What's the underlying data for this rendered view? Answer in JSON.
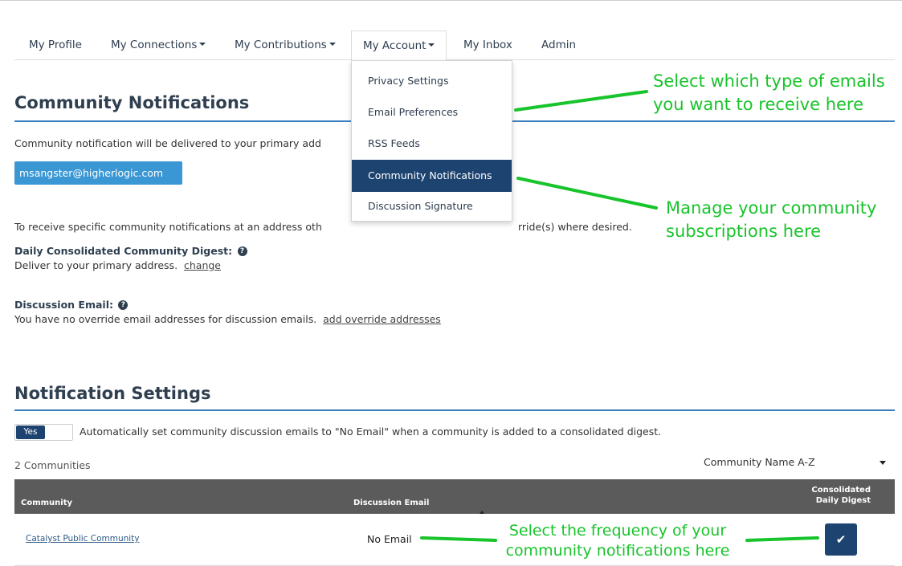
{
  "nav": {
    "tabs": [
      {
        "label": "My Profile",
        "caret": false
      },
      {
        "label": "My Connections",
        "caret": true
      },
      {
        "label": "My Contributions",
        "caret": true
      },
      {
        "label": "My Account",
        "caret": true,
        "active": true
      },
      {
        "label": "My Inbox",
        "caret": false
      },
      {
        "label": "Admin",
        "caret": false
      }
    ]
  },
  "dropdown": {
    "items": [
      "Privacy Settings",
      "Email Preferences",
      "RSS Feeds",
      "Community Notifications",
      "Discussion Signature"
    ],
    "selected_index": 3
  },
  "community_notifications": {
    "title": "Community Notifications",
    "intro": "Community notification will be delivered to your primary add",
    "primary_email": "msangster@higherlogic.com",
    "override_text_left": "To receive specific community notifications at an address oth",
    "override_text_right": "rride(s) where desired.",
    "daily_digest": {
      "label": "Daily Consolidated Community Digest:",
      "desc": "Deliver to your primary address.",
      "link": "change"
    },
    "discussion_email": {
      "label": "Discussion Email:",
      "desc": "You have no override email addresses for discussion emails.",
      "link": "add override addresses"
    }
  },
  "notification_settings": {
    "title": "Notification Settings",
    "toggle_label": "Yes",
    "toggle_on": true,
    "toggle_desc": "Automatically set community discussion emails to \"No Email\" when a community is added to a consolidated digest.",
    "count_text": "2 Communities",
    "sort_label": "Community Name A-Z",
    "table": {
      "headers": {
        "community": "Community",
        "discussion_email": "Discussion Email",
        "digest_line1": "Consolidated",
        "digest_line2": "Daily Digest"
      },
      "rows": [
        {
          "community": "Catalyst Public Community",
          "discussion_email": "No Email",
          "digest_checked": true
        }
      ]
    }
  },
  "annotations": {
    "emails": [
      "Select which type of emails",
      "you want to receive here"
    ],
    "subscriptions": [
      "Manage your community",
      "subscriptions here"
    ],
    "frequency": [
      "Select the frequency of your",
      "community notifications here"
    ]
  },
  "colors": {
    "accent": "#1d4370",
    "badge": "#3a97d4",
    "rule": "#3b7fbf",
    "annotation": "#18c42b",
    "table_header": "#5b5b5b"
  }
}
